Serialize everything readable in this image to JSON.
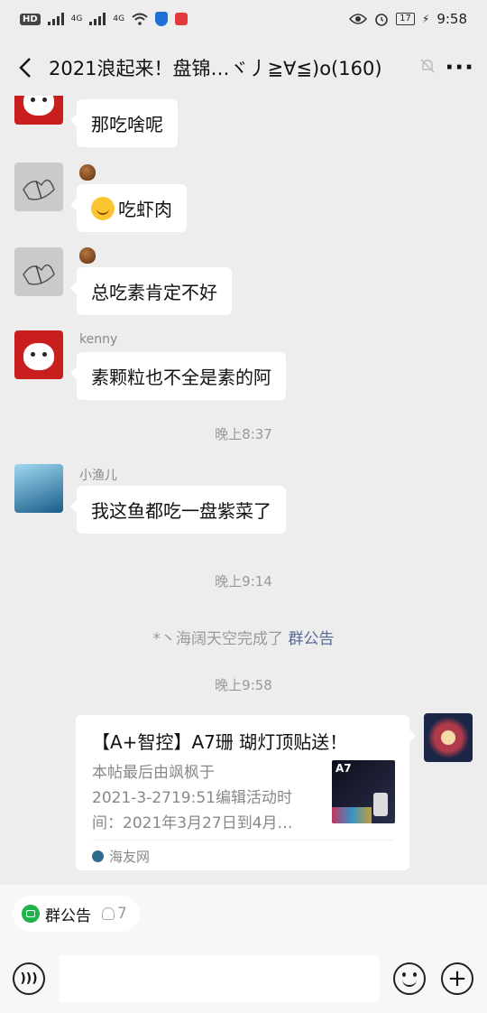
{
  "status_bar": {
    "network_badge": "HD",
    "signal_1": "4G",
    "signal_2": "4G",
    "battery": "17",
    "time": "9:58"
  },
  "header": {
    "title": "2021浪起来！盘锦…ヾ丿≧∀≦)o(160)"
  },
  "messages": [
    {
      "sender": "",
      "text": "那吃啥呢"
    },
    {
      "sender": "",
      "text": "吃虾肉"
    },
    {
      "sender": "",
      "text": "总吃素肯定不好"
    },
    {
      "sender": "kenny",
      "text": "素颗粒也不全是素的阿"
    },
    {
      "sender": "小渔儿",
      "text": "我这鱼都吃一盘紫菜了"
    }
  ],
  "timestamps": [
    "晚上8:37",
    "晚上9:14",
    "晚上9:58"
  ],
  "system_message": {
    "prefix": "*丶海阔天空完成了 ",
    "link": "群公告"
  },
  "shared_card": {
    "title": "【A+智控】A7珊 瑚灯顶贴送！",
    "desc_lines": [
      "本帖最后由飒枫于",
      "2021-3-2719:51编辑活动时",
      "间：2021年3月27日到4月…"
    ],
    "thumb_label": "A7",
    "source": "海友网"
  },
  "footer": {
    "notice_label": "群公告",
    "member_count": "7"
  },
  "icons": {
    "back": "back-arrow-icon",
    "mute": "mute-bell-icon",
    "more": "more-dots-icon",
    "voice": "voice-icon",
    "emoji": "emoji-icon",
    "plus": "plus-icon"
  }
}
